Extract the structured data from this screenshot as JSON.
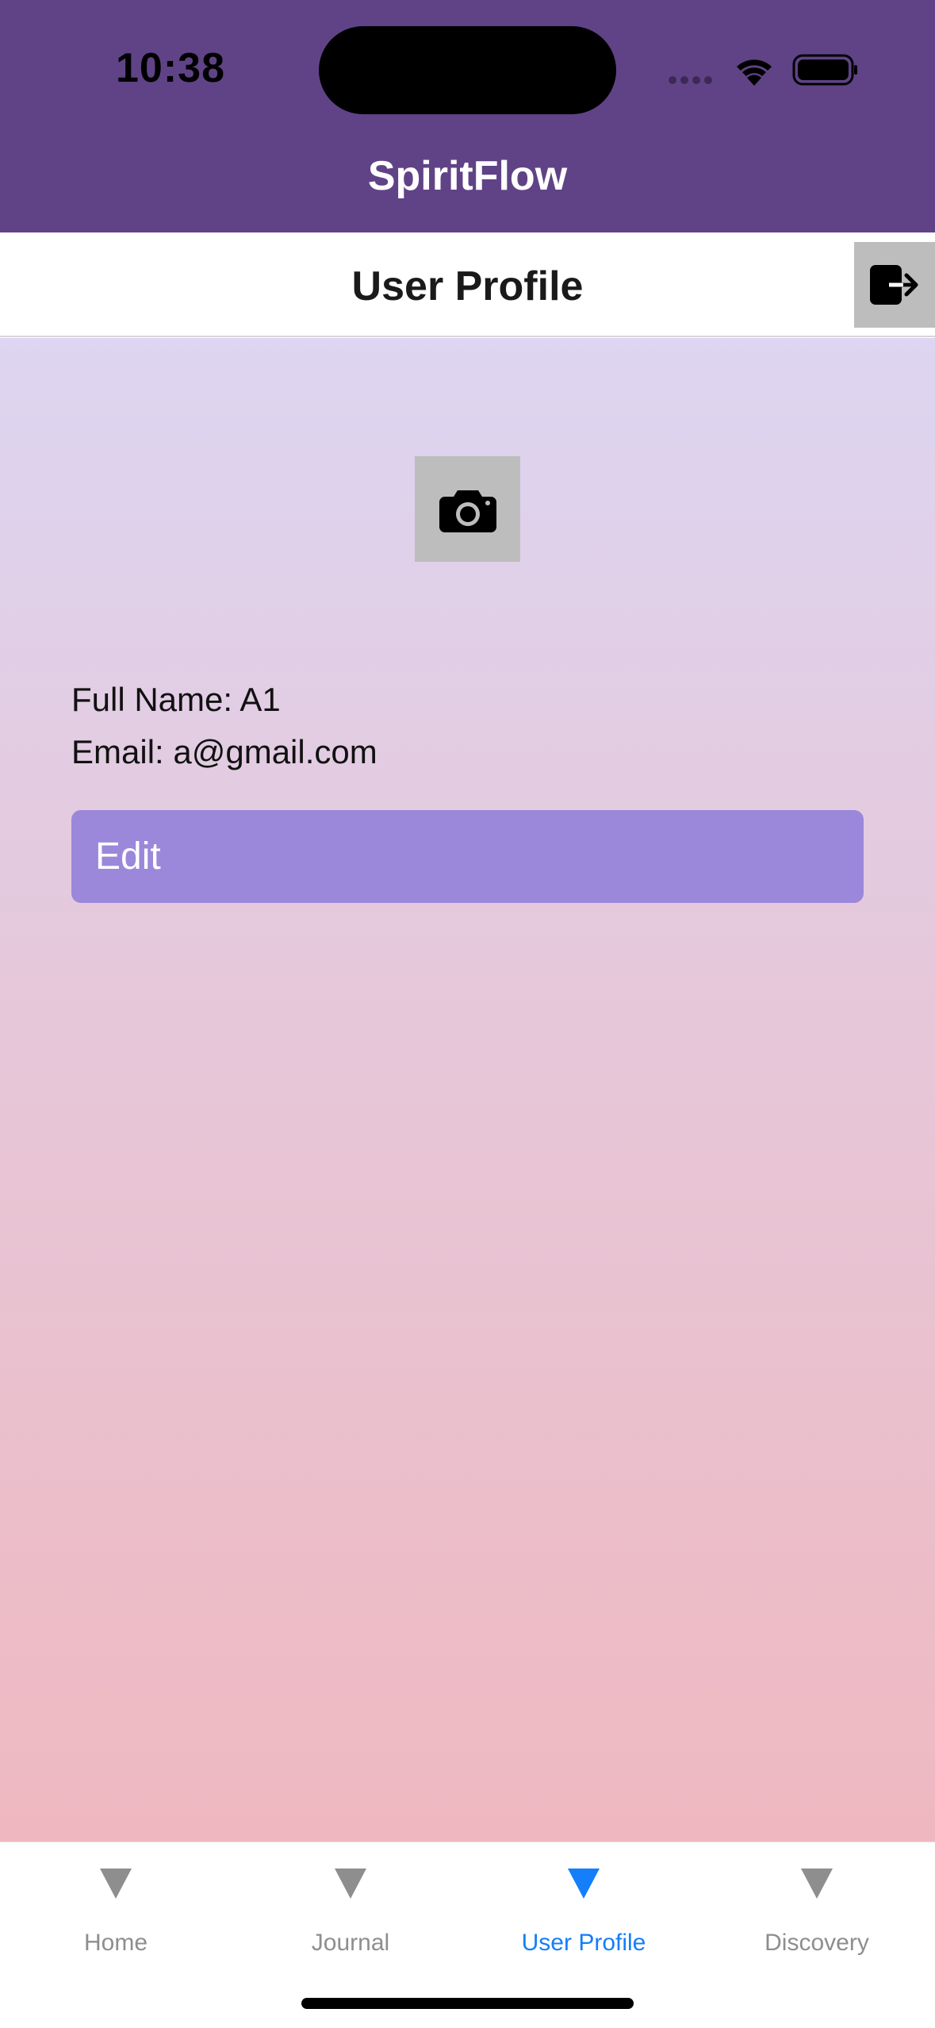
{
  "status_bar": {
    "time": "10:38"
  },
  "app": {
    "title": "SpiritFlow",
    "header_color": "#604386"
  },
  "page": {
    "title": "User Profile",
    "logout_icon": "logout-icon",
    "photo_icon": "camera-icon"
  },
  "profile": {
    "full_name_line": "Full Name: A1",
    "email_line": "Email: a@gmail.com",
    "edit_label": "Edit"
  },
  "tabbar": {
    "active_color": "#147efb",
    "inactive_color": "#8e8e8e",
    "tabs": [
      {
        "label": "Home",
        "icon": "triangle-down-icon",
        "active": false
      },
      {
        "label": "Journal",
        "icon": "triangle-down-icon",
        "active": false
      },
      {
        "label": "User Profile",
        "icon": "triangle-down-icon",
        "active": true
      },
      {
        "label": "Discovery",
        "icon": "triangle-down-icon",
        "active": false
      }
    ]
  }
}
